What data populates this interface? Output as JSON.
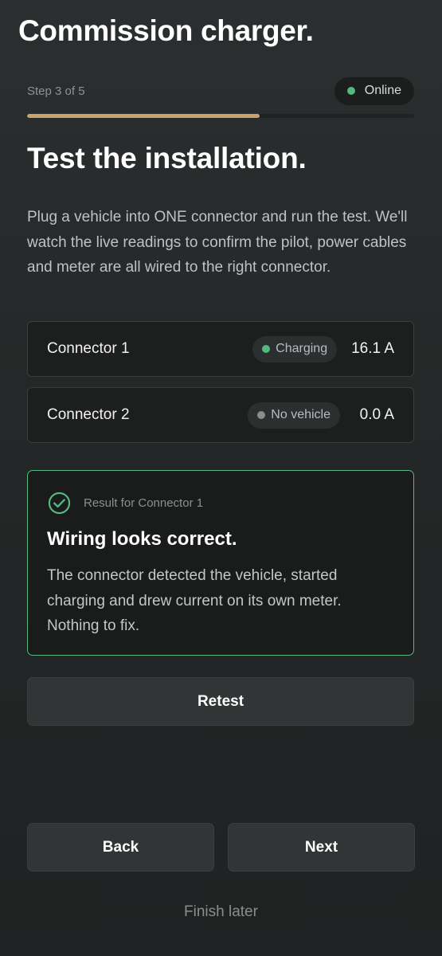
{
  "header": {
    "title": "Commission charger."
  },
  "progress": {
    "step_label": "Step 3 of 5",
    "fraction": 0.6,
    "status_label": "Online",
    "status_color": "#52b97e",
    "bar_color": "#c8a269"
  },
  "section": {
    "heading": "Test the installation.",
    "intro": "Plug a vehicle into ONE connector and run the test. We'll watch the live readings to confirm the pilot, power cables and meter are all wired to the right connector."
  },
  "connectors": [
    {
      "name": "Connector 1",
      "status": "Charging",
      "status_color": "#52b97e",
      "current": "16.1 A"
    },
    {
      "name": "Connector 2",
      "status": "No vehicle",
      "status_color": "#8c8c8c",
      "current": "0.0 A"
    }
  ],
  "result": {
    "label": "Result for Connector 1",
    "title": "Wiring looks correct.",
    "body": "The connector detected the vehicle, started charging and drew current on its own meter. Nothing to fix.",
    "icon": "check-circle-icon",
    "accent_color": "#57b882"
  },
  "actions": {
    "retest_label": "Retest",
    "back_label": "Back",
    "next_label": "Next",
    "finish_later_label": "Finish later"
  }
}
